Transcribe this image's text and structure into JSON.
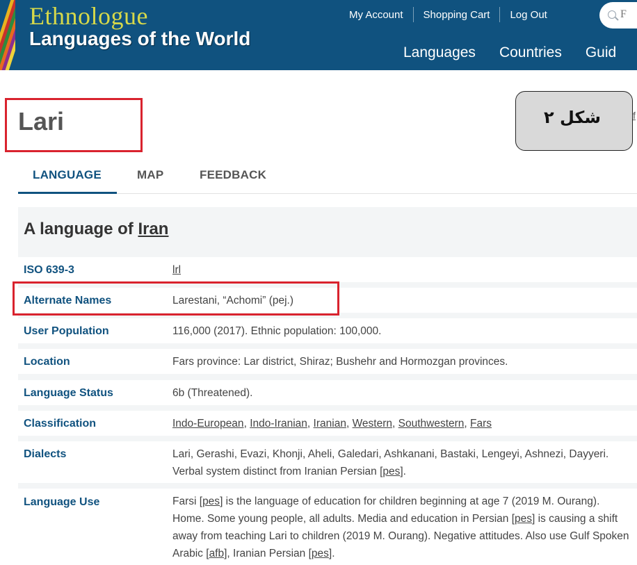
{
  "header": {
    "brand_title": "Ethnologue",
    "brand_subtitle": "Languages of the World",
    "util_links": [
      "My Account",
      "Shopping Cart",
      "Log Out"
    ],
    "search_placeholder": "F",
    "main_nav": [
      "Languages",
      "Countries",
      "Guid"
    ],
    "colors": {
      "background": "#10527f",
      "title": "#d6d84a"
    }
  },
  "page": {
    "title": "Lari",
    "edge_link": "f",
    "callout_label": "شکل ۲",
    "highlight_color": "#d9232e"
  },
  "tabs": [
    {
      "label": "LANGUAGE",
      "active": true
    },
    {
      "label": "MAP",
      "active": false
    },
    {
      "label": "FEEDBACK",
      "active": false
    }
  ],
  "section": {
    "heading_prefix": "A language of ",
    "heading_country": "Iran"
  },
  "fields": {
    "iso": {
      "label": "ISO 639-3",
      "value": "lrl"
    },
    "alternate_names": {
      "label": "Alternate Names",
      "value": "Larestani, “Achomi” (pej.)"
    },
    "user_population": {
      "label": "User Population",
      "value": "116,000 (2017). Ethnic population: 100,000."
    },
    "location": {
      "label": "Location",
      "value": "Fars province: Lar district, Shiraz; Bushehr and Hormozgan provinces."
    },
    "language_status": {
      "label": "Language Status",
      "value": "6b (Threatened)."
    },
    "classification": {
      "label": "Classification",
      "links": [
        "Indo-European",
        "Indo-Iranian",
        "Iranian",
        "Western",
        "Southwestern",
        "Fars"
      ]
    },
    "dialects": {
      "label": "Dialects",
      "text_1": "Lari, Gerashi, Evazi, Khonji, Aheli, Galedari, Ashkanani, Bastaki, Lengeyi, Ashnezi, Dayyeri. Verbal system distinct from Iranian Persian [",
      "link_1": "pes",
      "text_2": "]."
    },
    "language_use": {
      "label": "Language Use",
      "text_1": "Farsi [",
      "link_1": "pes",
      "text_2": "] is the language of education for children beginning at age 7 (2019 M. Ourang). Home. Some young people, all adults. Media and education in Persian [",
      "link_2": "pes",
      "text_3": "] is causing a shift away from teaching Lari to children (2019 M. Ourang). Negative attitudes. Also use Gulf Spoken Arabic [",
      "link_3": "afb",
      "text_4": "], Iranian Persian [",
      "link_4": "pes",
      "text_5": "]."
    }
  }
}
